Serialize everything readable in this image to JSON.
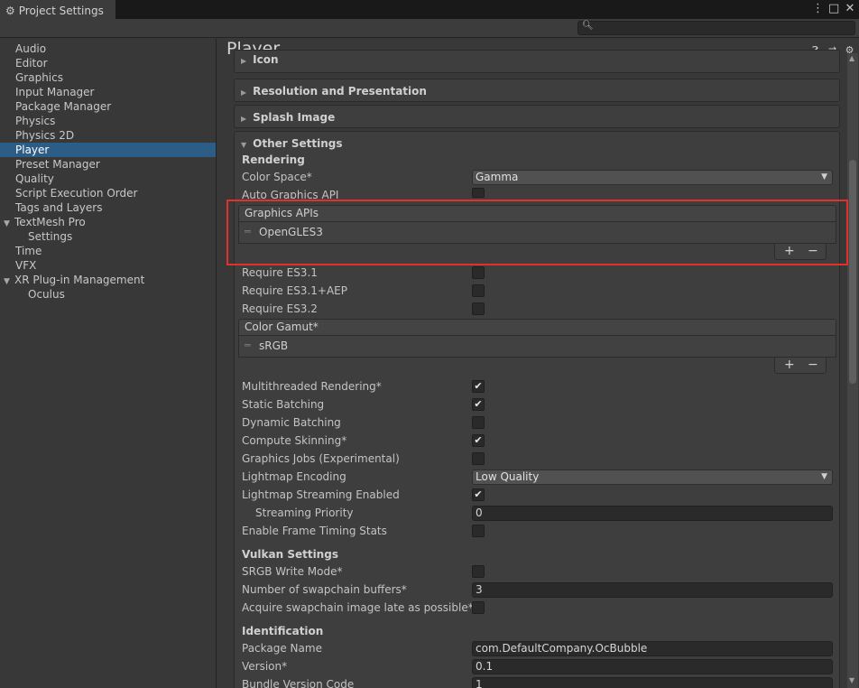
{
  "window": {
    "tab_title": "Project Settings",
    "controls": [
      "⋮",
      "□",
      "✕"
    ]
  },
  "sidebar": {
    "items": [
      {
        "label": "Audio"
      },
      {
        "label": "Editor"
      },
      {
        "label": "Graphics"
      },
      {
        "label": "Input Manager"
      },
      {
        "label": "Package Manager"
      },
      {
        "label": "Physics"
      },
      {
        "label": "Physics 2D"
      },
      {
        "label": "Player",
        "selected": true
      },
      {
        "label": "Preset Manager"
      },
      {
        "label": "Quality"
      },
      {
        "label": "Script Execution Order"
      },
      {
        "label": "Tags and Layers"
      },
      {
        "label": "TextMesh Pro",
        "expandable": true
      },
      {
        "label": "Settings",
        "child": true
      },
      {
        "label": "Time"
      },
      {
        "label": "VFX"
      },
      {
        "label": "XR Plug-in Management",
        "expandable": true
      },
      {
        "label": "Oculus",
        "child": true
      }
    ]
  },
  "main": {
    "title": "Player",
    "header_icons": [
      "help-icon",
      "preset-icon",
      "settings-icon"
    ],
    "sections": {
      "icon": "Icon",
      "resolution": "Resolution and Presentation",
      "splash": "Splash Image",
      "other": "Other Settings"
    },
    "rendering": {
      "heading": "Rendering",
      "color_space_label": "Color Space*",
      "color_space_value": "Gamma",
      "auto_graphics_label": "Auto Graphics API",
      "auto_graphics_checked": false,
      "graphics_apis_header": "Graphics APIs",
      "graphics_apis_items": [
        "OpenGLES3"
      ],
      "require_es31_label": "Require ES3.1",
      "require_es31aep_label": "Require ES3.1+AEP",
      "require_es32_label": "Require ES3.2",
      "color_gamut_header": "Color Gamut*",
      "color_gamut_items": [
        "sRGB"
      ],
      "multithreaded_label": "Multithreaded Rendering*",
      "static_batching_label": "Static Batching",
      "dynamic_batching_label": "Dynamic Batching",
      "compute_skinning_label": "Compute Skinning*",
      "graphics_jobs_label": "Graphics Jobs (Experimental)",
      "lightmap_encoding_label": "Lightmap Encoding",
      "lightmap_encoding_value": "Low Quality",
      "lightmap_streaming_label": "Lightmap Streaming Enabled",
      "streaming_priority_label": "Streaming Priority",
      "streaming_priority_value": "0",
      "frame_timing_label": "Enable Frame Timing Stats"
    },
    "vulkan": {
      "heading": "Vulkan Settings",
      "srgb_label": "SRGB Write Mode*",
      "swapchain_label": "Number of swapchain buffers*",
      "swapchain_value": "3",
      "acquire_label": "Acquire swapchain image late as possible*"
    },
    "identification": {
      "heading": "Identification",
      "package_name_label": "Package Name",
      "package_name_value": "com.DefaultCompany.OcBubble",
      "version_label": "Version*",
      "version_value": "0.1",
      "bundle_code_label": "Bundle Version Code",
      "bundle_code_value": "1"
    },
    "list_buttons": {
      "add": "+",
      "remove": "−"
    },
    "checkmark": "✔"
  },
  "colors": {
    "selection": "#2c5d87",
    "highlight_box": "#e0322a"
  }
}
